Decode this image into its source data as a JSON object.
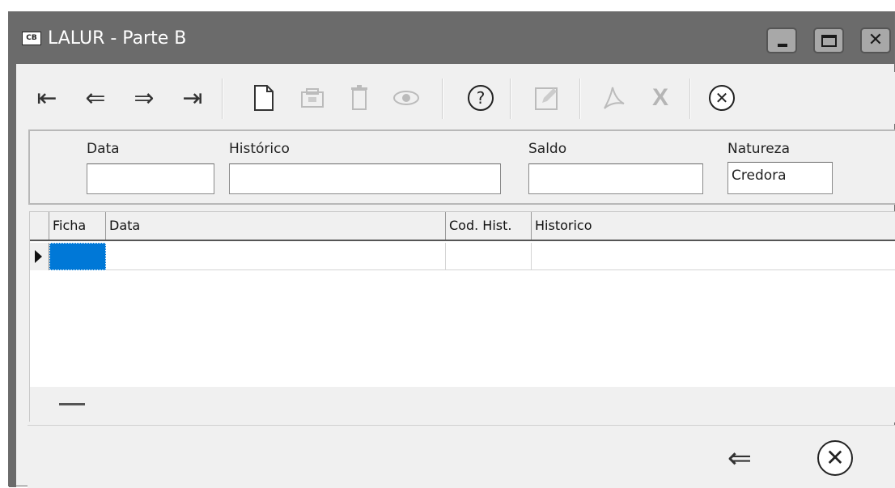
{
  "window": {
    "title": "LALUR - Parte B",
    "icon_text": "CB",
    "controls": [
      "minimize-icon",
      "maximize-icon",
      "close-icon"
    ]
  },
  "toolbar": {
    "buttons": [
      {
        "name": "first-record",
        "icon": "first-record-icon",
        "glyph": "⇤",
        "enabled": true
      },
      {
        "name": "previous-record",
        "icon": "previous-record-icon",
        "glyph": "⇐",
        "enabled": true
      },
      {
        "name": "next-record",
        "icon": "next-record-icon",
        "glyph": "⇒",
        "enabled": true
      },
      {
        "name": "last-record",
        "icon": "last-record-icon",
        "glyph": "⇥",
        "enabled": true
      },
      {
        "name": "new",
        "icon": "new-document-icon",
        "glyph": "🗋",
        "enabled": true
      },
      {
        "name": "save",
        "icon": "save-icon",
        "glyph": "🖫",
        "enabled": false
      },
      {
        "name": "delete",
        "icon": "trash-icon",
        "glyph": "🗑",
        "enabled": false
      },
      {
        "name": "view",
        "icon": "eye-icon",
        "glyph": "◉",
        "enabled": false
      },
      {
        "name": "help",
        "icon": "help-icon",
        "glyph": "?",
        "enabled": true
      },
      {
        "name": "edit",
        "icon": "edit-icon",
        "glyph": "✎",
        "enabled": false
      },
      {
        "name": "pdf",
        "icon": "pdf-icon",
        "glyph": "⅄",
        "enabled": false
      },
      {
        "name": "excel",
        "icon": "excel-icon",
        "glyph": "X",
        "enabled": false
      },
      {
        "name": "close",
        "icon": "close-circle-icon",
        "glyph": "✖",
        "enabled": true
      }
    ]
  },
  "fields": {
    "data_label": "Data",
    "data_value": "",
    "historico_label": "Histórico",
    "historico_value": "",
    "saldo_label": "Saldo",
    "saldo_value": "",
    "natureza_label": "Natureza",
    "natureza_value": "Credora"
  },
  "grid": {
    "columns": [
      "Ficha",
      "Data",
      "Cod. Hist.",
      "Historico"
    ],
    "rows": [
      {
        "ficha": "",
        "data": "",
        "cod_hist": "",
        "historico": ""
      }
    ]
  },
  "footer": {
    "back_icon": "back-arrow-icon",
    "close_icon": "close-circle-icon"
  },
  "colors": {
    "titlebar": "#6b6b6b",
    "selection": "#0078d7",
    "background": "#f0f0f0"
  }
}
